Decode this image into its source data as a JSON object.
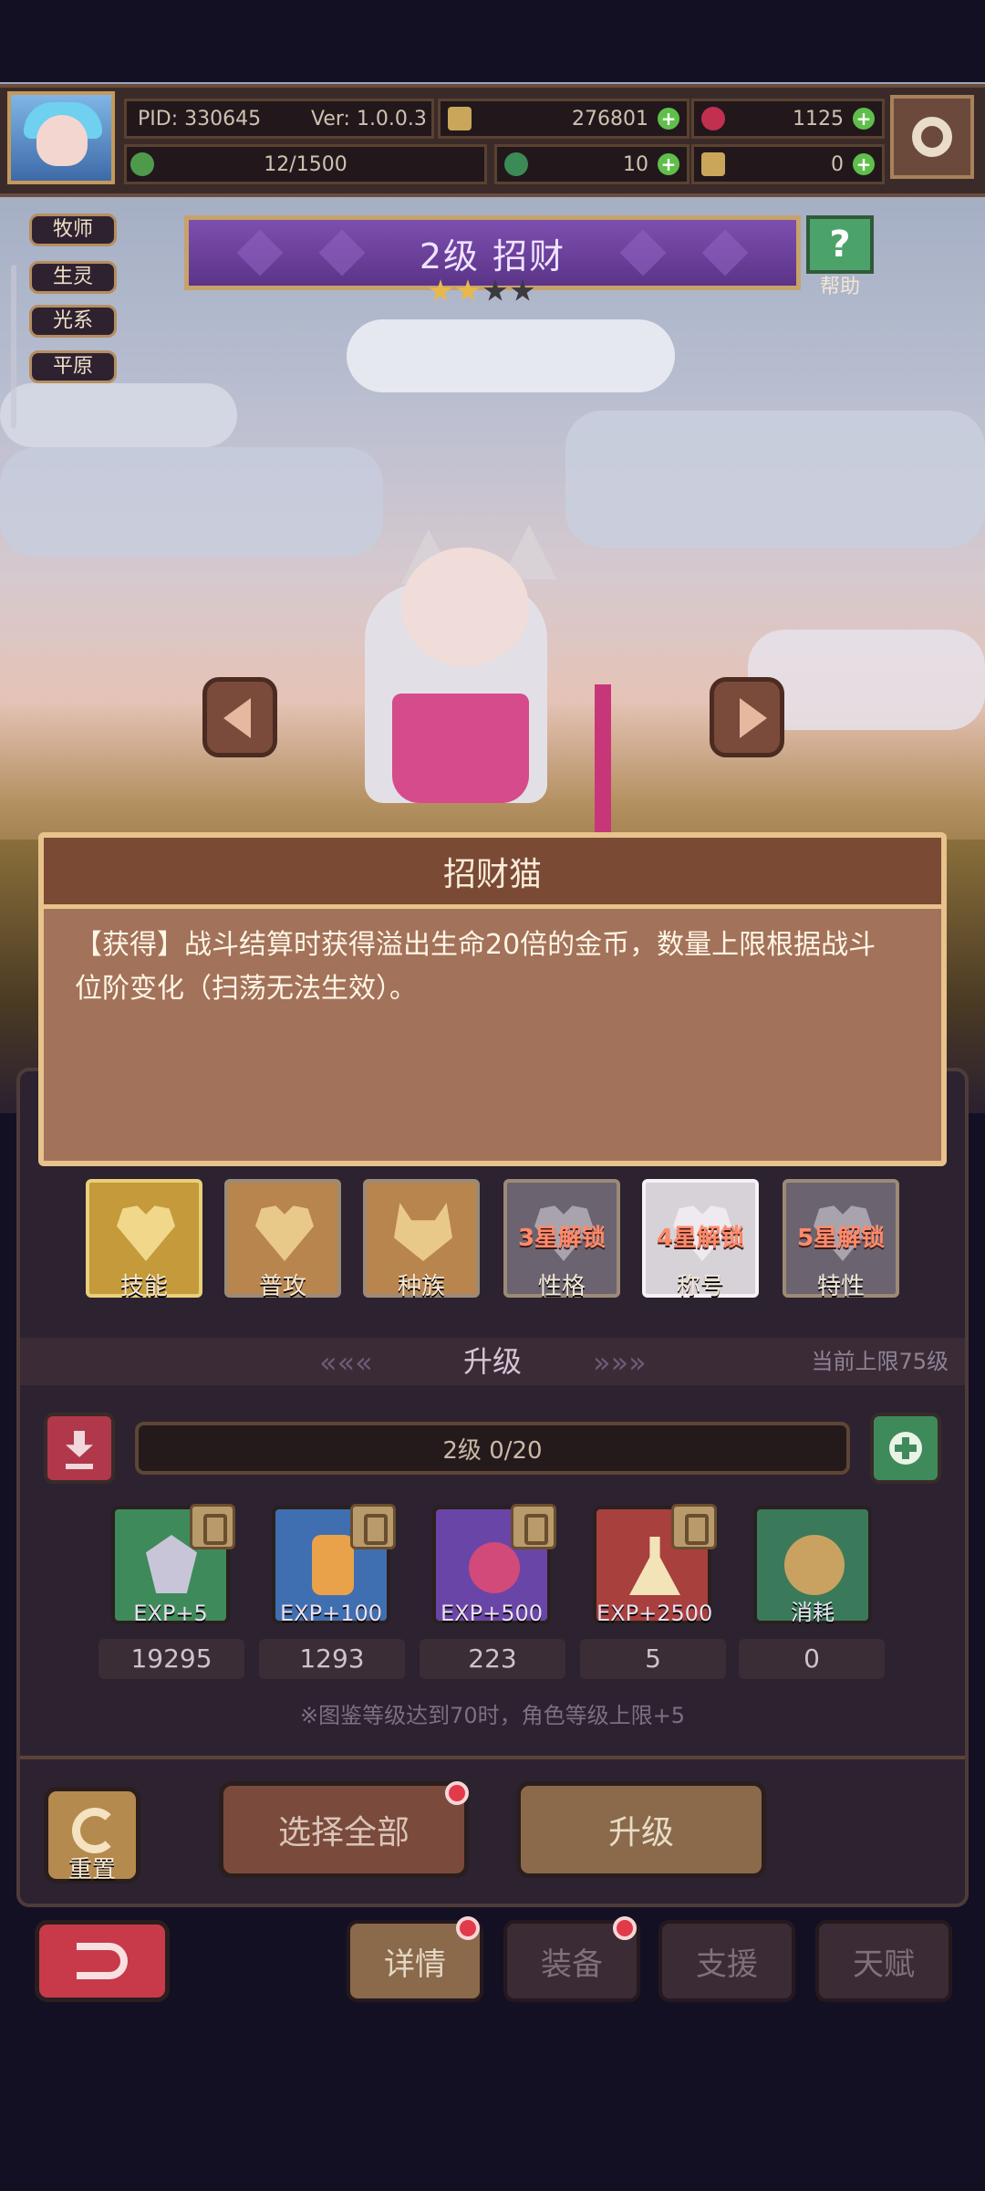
{
  "hud": {
    "pid": "PID: 330645",
    "version": "Ver: 1.0.0.3",
    "gold": "276801",
    "gems": "1125",
    "stamina": "12/1500",
    "clover": "10",
    "feather": "0"
  },
  "tags": [
    "牧师",
    "生灵",
    "光系",
    "平原"
  ],
  "banner": {
    "title": "2级  招财",
    "help_label": "帮助",
    "stars_filled": 2,
    "stars_total": 4
  },
  "popup": {
    "title": "招财猫",
    "line1": "【获得】战斗结算时获得溢出生命20倍的金币，数量上限根据战斗",
    "line2": "位阶变化（扫荡无法生效）。"
  },
  "tabs_row": [
    {
      "label": "技能",
      "lock": ""
    },
    {
      "label": "普攻",
      "lock": ""
    },
    {
      "label": "种族",
      "lock": ""
    },
    {
      "label": "性格",
      "lock": "3星解锁"
    },
    {
      "label": "称号",
      "lock": "4星解锁"
    },
    {
      "label": "特性",
      "lock": "5星解锁"
    }
  ],
  "upgrade": {
    "title": "升级",
    "limit": "当前上限75级",
    "progress": "2级  0/20",
    "items": [
      {
        "caption": "EXP+5",
        "count": "19295",
        "color": "#3f8a5a"
      },
      {
        "caption": "EXP+100",
        "count": "1293",
        "color": "#3f6fb0"
      },
      {
        "caption": "EXP+500",
        "count": "223",
        "color": "#6a45a8"
      },
      {
        "caption": "EXP+2500",
        "count": "5",
        "color": "#a8403e"
      },
      {
        "caption": "消耗",
        "count": "0",
        "color": "#3a7a5a"
      }
    ],
    "note": "※图鉴等级达到70时，角色等级上限+5"
  },
  "actions": {
    "reset": "重置",
    "select_all": "选择全部",
    "upgrade": "升级"
  },
  "bottom_tabs": [
    "详情",
    "装备",
    "支援",
    "天赋"
  ]
}
